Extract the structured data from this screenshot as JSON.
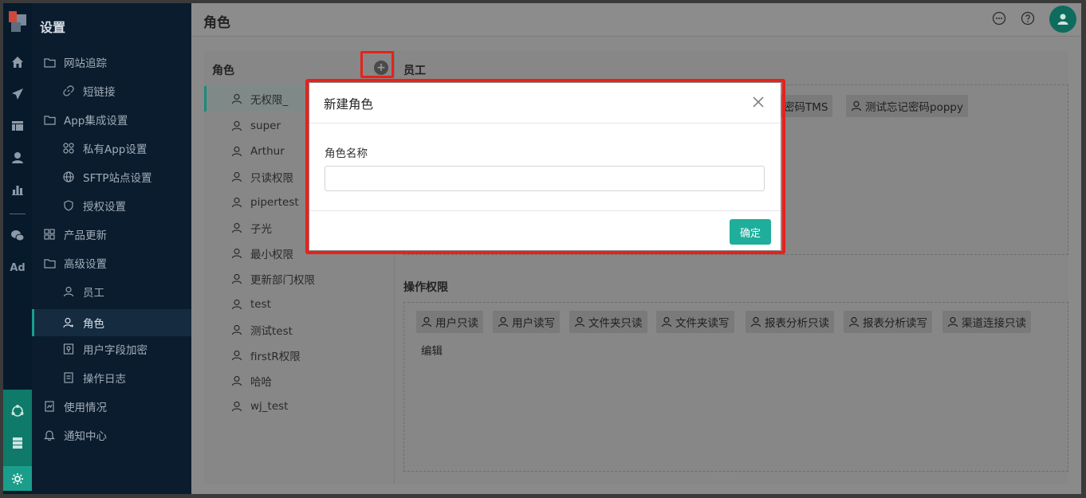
{
  "sidebar": {
    "title": "设置",
    "items": [
      {
        "label": "网站追踪",
        "icon": "folder-icon",
        "level": 1
      },
      {
        "label": "短链接",
        "icon": "link-icon",
        "level": 2
      },
      {
        "label": "App集成设置",
        "icon": "folder-icon",
        "level": 1
      },
      {
        "label": "私有App设置",
        "icon": "apps-icon",
        "level": 2
      },
      {
        "label": "SFTP站点设置",
        "icon": "globe-icon",
        "level": 2
      },
      {
        "label": "授权设置",
        "icon": "shield-icon",
        "level": 2
      },
      {
        "label": "产品更新",
        "icon": "grid-icon",
        "level": 1
      },
      {
        "label": "高级设置",
        "icon": "folder-icon",
        "level": 1
      },
      {
        "label": "员工",
        "icon": "user-icon",
        "level": 2
      },
      {
        "label": "角色",
        "icon": "user-role-icon",
        "level": 2,
        "active": true
      },
      {
        "label": "用户字段加密",
        "icon": "encrypt-icon",
        "level": 2
      },
      {
        "label": "操作日志",
        "icon": "log-icon",
        "level": 2
      },
      {
        "label": "使用情况",
        "icon": "usage-icon",
        "level": 1
      },
      {
        "label": "通知中心",
        "icon": "bell-icon",
        "level": 1
      }
    ]
  },
  "rail": {
    "icons": [
      "home-icon",
      "send-icon",
      "table-icon",
      "person-icon",
      "chart-icon",
      "wechat-icon"
    ],
    "ad_label": "Ad",
    "bottom_icons": [
      "network-icon",
      "server-icon",
      "settings-icon"
    ]
  },
  "header": {
    "title": "角色",
    "icons": [
      "chat-icon",
      "help-icon",
      "avatar-icon"
    ]
  },
  "roles_panel": {
    "heading": "角色",
    "add_symbol": "+",
    "roles": [
      "无权限_",
      "super",
      "Arthur",
      "只读权限",
      "pipertest",
      "子光",
      "最小权限",
      "更新部门权限",
      "test",
      "测试test",
      "firstR权限",
      "哈哈",
      "wj_test"
    ],
    "active_index": 0
  },
  "employees": {
    "heading": "员工",
    "tags": [
      "密码TMS",
      "测试忘记密码poppy"
    ]
  },
  "operations": {
    "heading": "操作权限",
    "tags": [
      "用户只读",
      "用户读写",
      "文件夹只读",
      "文件夹读写",
      "报表分析只读",
      "报表分析读写",
      "渠道连接只读"
    ],
    "edit_label": "编辑"
  },
  "modal": {
    "title": "新建角色",
    "field_label": "角色名称",
    "field_value": "",
    "field_placeholder": "",
    "confirm_label": "确定"
  },
  "colors": {
    "accent": "#1fae9b",
    "highlight": "#e8211a",
    "sidebar_bg": "#0a1c2e"
  }
}
